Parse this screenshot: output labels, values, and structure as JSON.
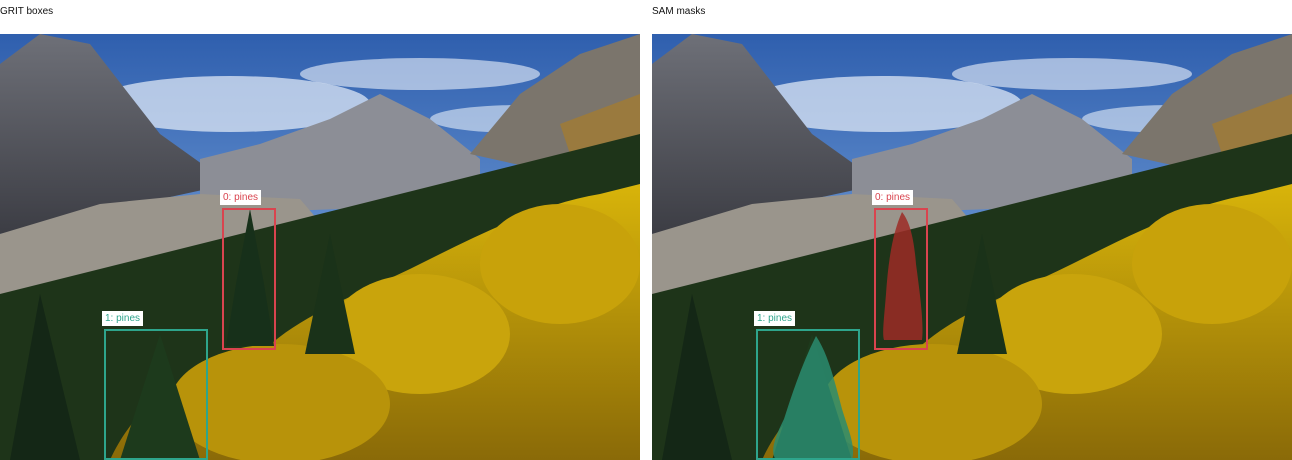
{
  "panels": [
    {
      "title": "GRIT boxes"
    },
    {
      "title": "SAM masks"
    }
  ],
  "detections": [
    {
      "label": "0: pines",
      "color": "#d9444f",
      "mask_color": "#9c2b26"
    },
    {
      "label": "1: pines",
      "color": "#2ea58c",
      "mask_color": "#2a8c70"
    }
  ]
}
